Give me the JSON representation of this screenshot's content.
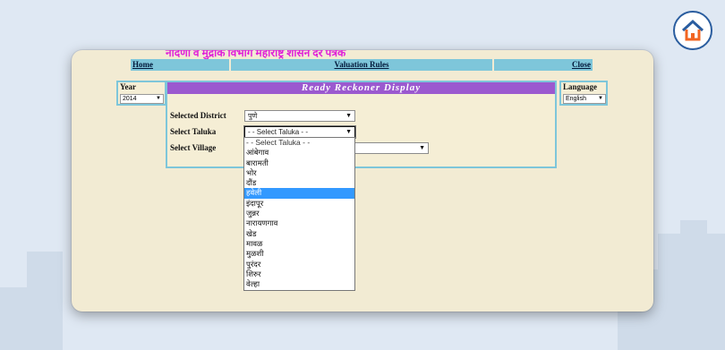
{
  "header_text": "नोंदणी व मुद्रांक विभाग महाराष्ट्र शासन दर पत्रक",
  "nav": {
    "home": "Home",
    "valuation_rules": "Valuation Rules",
    "close": "Close"
  },
  "year": {
    "label": "Year",
    "value": "2014"
  },
  "language": {
    "label": "Language",
    "value": "English"
  },
  "panel_title": "Ready Reckoner Display",
  "form": {
    "district_label": "Selected District",
    "district_value": "पुणे",
    "taluka_label": "Select Taluka",
    "taluka_value": "- - Select Taluka - -",
    "village_label": "Select Village"
  },
  "taluka_options": [
    "- - Select Taluka - -",
    "आंबेगाव",
    "बारामती",
    "भोर",
    "दौंड",
    "हवेली",
    "इंदापूर",
    "जुन्नर",
    "नारायणगाव",
    "खेड",
    "मावळ",
    "मुळशी",
    "पुरंदर",
    "शिरुर",
    "वेल्हा"
  ],
  "highlighted_option_index": 5,
  "colors": {
    "nav_bg": "#7ec6da",
    "title_bg": "#9b59cf",
    "header_text": "#e01fd8",
    "highlight": "#3399ff",
    "card_bg": "#f2ebd3"
  }
}
